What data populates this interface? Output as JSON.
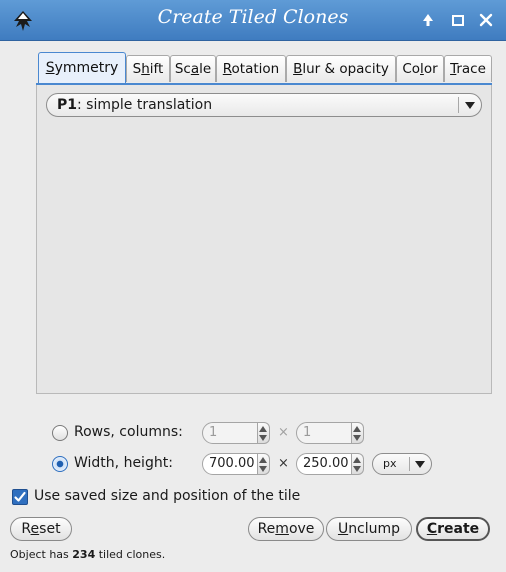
{
  "window": {
    "title": "Create Tiled Clones",
    "icons": [
      "inkscape-logo-icon",
      "keep-above-icon",
      "maximize-icon",
      "close-icon"
    ],
    "accent_color": "#4a88d0"
  },
  "tabs": [
    {
      "pre": "",
      "mn": "S",
      "post": "ymmetry",
      "active": true
    },
    {
      "pre": "S",
      "mn": "h",
      "post": "ift",
      "active": false
    },
    {
      "pre": "Sc",
      "mn": "a",
      "post": "le",
      "active": false
    },
    {
      "pre": "",
      "mn": "R",
      "post": "otation",
      "active": false
    },
    {
      "pre": "",
      "mn": "B",
      "post": "lur & opacity",
      "active": false
    },
    {
      "pre": "Co",
      "mn": "l",
      "post": "or",
      "active": false
    },
    {
      "pre": "",
      "mn": "T",
      "post": "race",
      "active": false
    }
  ],
  "symmetry": {
    "selected_bold": "P1",
    "selected_rest": ": simple translation"
  },
  "size": {
    "rows_label": "Rows, columns:",
    "rows_value": "1",
    "columns_value": "1",
    "times_sign": "×",
    "width_height_label": "Width, height:",
    "width_value": "700.00",
    "height_value": "250.00",
    "unit": "px",
    "selected_mode": "width_height"
  },
  "options": {
    "use_saved_label": "Use saved size and position of the tile",
    "use_saved_checked": true
  },
  "buttons": {
    "reset": {
      "pre": "R",
      "mn": "e",
      "post": "set"
    },
    "remove": {
      "pre": "Re",
      "mn": "m",
      "post": "ove"
    },
    "unclump": {
      "pre": "",
      "mn": "U",
      "post": "nclump"
    },
    "create": {
      "pre": "",
      "mn": "C",
      "post": "reate"
    }
  },
  "status": {
    "prefix": "Object has ",
    "count": "234",
    "suffix": " tiled clones."
  }
}
